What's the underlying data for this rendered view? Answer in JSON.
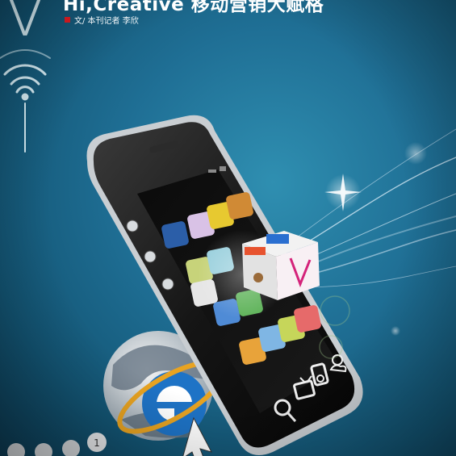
{
  "article": {
    "headline": "Hi,Creative 移动营销大赋格",
    "byline": "文/ 本刊记者 李欣"
  },
  "colors": {
    "background": "#1f6f95",
    "accent_marker": "#c8191f",
    "ie_blue": "#1e73c6",
    "ie_orbit": "#e8a321"
  },
  "illustration": {
    "icons": [
      "lightbulb-wifi-icon",
      "smartphone",
      "internet-explorer-logo",
      "globe-icon",
      "floating-app-cube-icon",
      "search-icon",
      "tv-icon",
      "ipod-icon",
      "weather-icon"
    ],
    "app_grid": {
      "rows": 5,
      "columns": 4
    }
  }
}
